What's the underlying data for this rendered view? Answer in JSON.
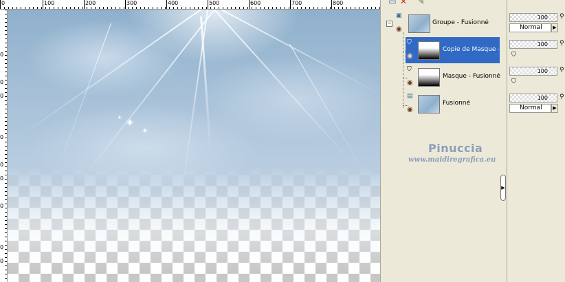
{
  "ruler": {
    "top_labels": [
      "0",
      "100",
      "200",
      "300",
      "400",
      "500",
      "600",
      "700",
      "800"
    ],
    "left_labels": [
      "0",
      "0",
      "0",
      "0",
      "0",
      "0",
      "0",
      "0",
      "0"
    ]
  },
  "toolbar": {
    "icons": [
      "new-layer-icon",
      "delete-layer-icon",
      "edit-layer-icon"
    ]
  },
  "layers": [
    {
      "name": "Groupe - Fusionné",
      "type": "group",
      "selected": false,
      "thumb": "sky"
    },
    {
      "name": "Copie de Masque - Fu",
      "type": "mask",
      "selected": true,
      "thumb": "mask"
    },
    {
      "name": "Masque - Fusionné",
      "type": "mask",
      "selected": false,
      "thumb": "mask"
    },
    {
      "name": "Fusionné",
      "type": "raster",
      "selected": false,
      "thumb": "sky"
    }
  ],
  "watermark": {
    "name": "Pinuccia",
    "url": "www.maidiregrafica.eu"
  },
  "properties": [
    {
      "opacity": "100",
      "blend": "Normal",
      "show_blend": true
    },
    {
      "opacity": "100",
      "blend": "",
      "show_blend": false
    },
    {
      "opacity": "100",
      "blend": "",
      "show_blend": false
    },
    {
      "opacity": "100",
      "blend": "Normal",
      "show_blend": true
    }
  ],
  "colors": {
    "selection": "#316ac5",
    "panel": "#ece9d8",
    "sky": "#8fb0cc"
  }
}
